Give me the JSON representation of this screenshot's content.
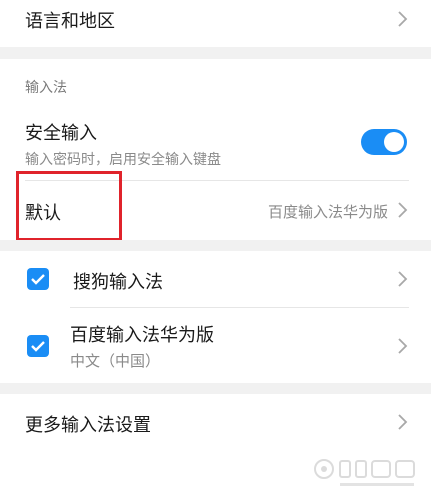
{
  "language_region": {
    "label": "语言和地区"
  },
  "ime_section": {
    "header": "输入法",
    "secure_input": {
      "label": "安全输入",
      "description": "输入密码时，启用安全输入键盘",
      "enabled": true
    },
    "default": {
      "label": "默认",
      "value": "百度输入法华为版"
    }
  },
  "installed_ime": [
    {
      "label": "搜狗输入法",
      "checked": true
    },
    {
      "label": "百度输入法华为版",
      "sublabel": "中文（中国）",
      "checked": true
    }
  ],
  "more_settings": {
    "label": "更多输入法设置"
  },
  "colors": {
    "accent": "#1a8df5",
    "highlight": "#e0232b",
    "separator": "#f1f1f1"
  },
  "icons": {
    "chevron": "chevron-right-icon",
    "check": "check-icon",
    "toggle": "toggle-switch"
  }
}
